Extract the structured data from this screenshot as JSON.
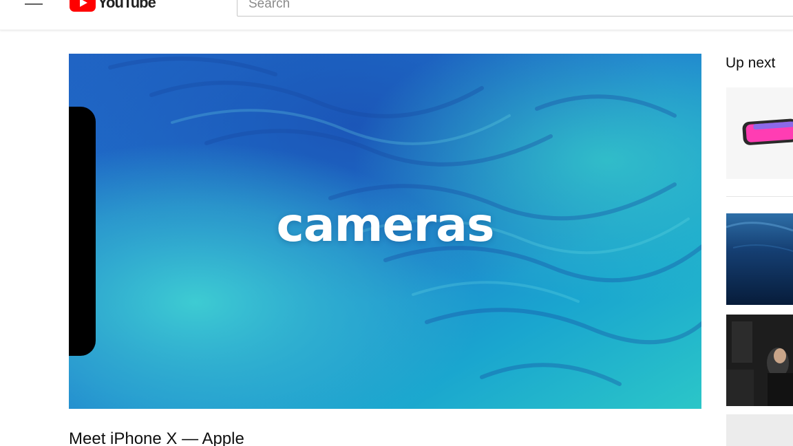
{
  "header": {
    "logo_text": "YouTube",
    "search_placeholder": "Search"
  },
  "player": {
    "overlay_text": "cameras"
  },
  "video": {
    "title": "Meet iPhone X — Apple"
  },
  "sidebar": {
    "up_next_label": "Up next"
  },
  "icons": {
    "menu": "hamburger-menu-icon",
    "logo": "youtube-logo-icon"
  },
  "colors": {
    "brand_red": "#ff0000",
    "player_blue": "#1e73c8",
    "player_teal": "#2cc3c6"
  }
}
